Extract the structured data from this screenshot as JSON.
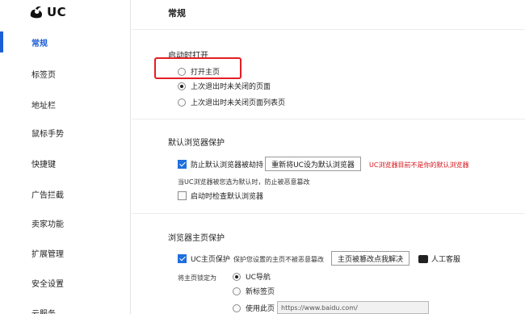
{
  "brand": {
    "name": "UC"
  },
  "sidebar": {
    "items": [
      {
        "label": "常规",
        "active": true
      },
      {
        "label": "标签页",
        "active": false
      },
      {
        "label": "地址栏",
        "active": false
      },
      {
        "label": "鼠标手势",
        "active": false
      },
      {
        "label": "快捷键",
        "active": false
      },
      {
        "label": "广告拦截",
        "active": false
      },
      {
        "label": "卖家功能",
        "active": false
      },
      {
        "label": "扩展管理",
        "active": false
      },
      {
        "label": "安全设置",
        "active": false
      },
      {
        "label": "云服务",
        "active": false
      }
    ]
  },
  "main": {
    "title": "常规",
    "startup": {
      "title": "启动时打开",
      "options": [
        {
          "label": "打开主页",
          "selected": false
        },
        {
          "label": "上次退出时未关闭的页面",
          "selected": true
        },
        {
          "label": "上次退出时未关闭页面列表页",
          "selected": false
        }
      ]
    },
    "default_browser": {
      "title": "默认浏览器保护",
      "protect_label": "防止默认浏览器被劫持",
      "protect_checked": true,
      "reset_button": "重新将UC设为默认浏览器",
      "warning": "UC浏览器目前不是你的默认浏览器",
      "note": "当UC浏览器被您选为默认时，防止被恶意篡改",
      "check_on_start_label": "启动时检查默认浏览器",
      "check_on_start_checked": false
    },
    "homepage": {
      "title": "浏览器主页保护",
      "protect_label": "UC主页保护",
      "protect_checked": true,
      "protect_desc": "保护您设置的主页不被恶意篡改",
      "fix_button": "主页被篡改点我解决",
      "support_label": "人工客服",
      "lock_label": "将主页锁定为",
      "lock_options": [
        {
          "label": "UC导航",
          "selected": true
        },
        {
          "label": "新标签页",
          "selected": false
        },
        {
          "label": "使用此页",
          "selected": false
        }
      ],
      "url_value": "https://www.baidu.com/"
    }
  },
  "colors": {
    "accent": "#1c5fd6",
    "warning": "#d4141b",
    "highlight": "#e31e24"
  }
}
